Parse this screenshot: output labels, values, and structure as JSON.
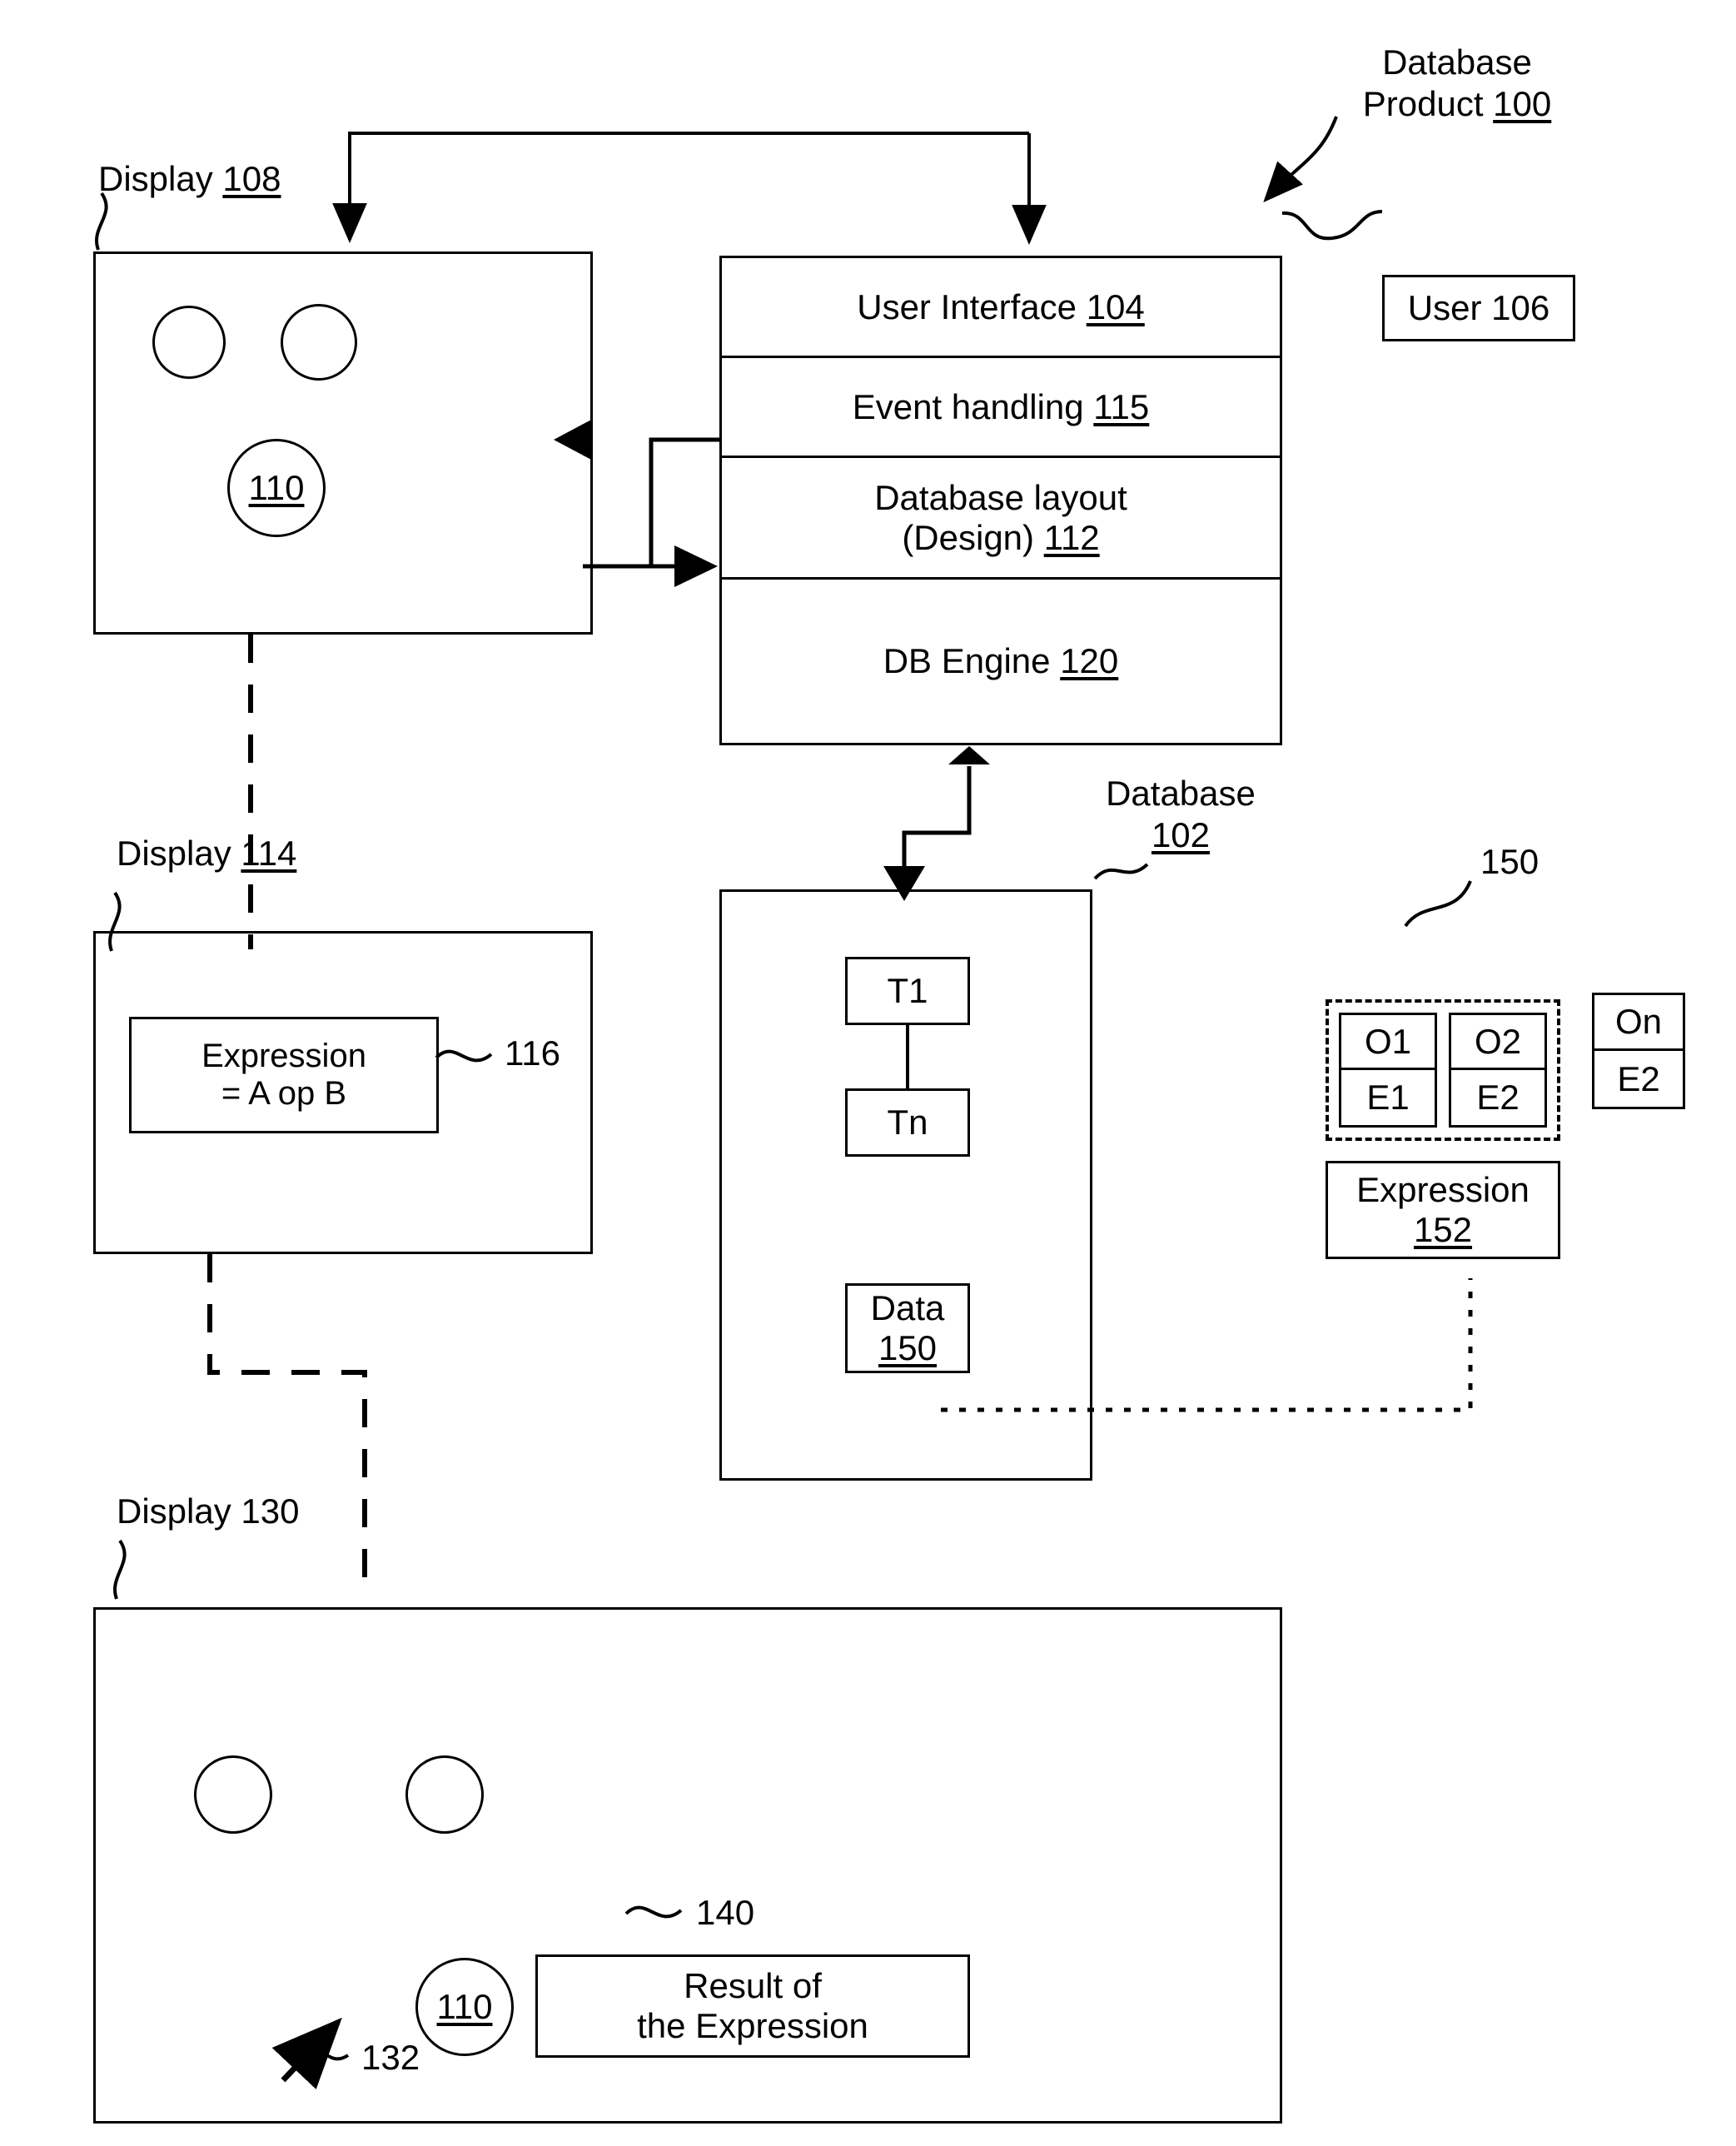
{
  "figure": {
    "domain": "patent-block-diagram",
    "product_callout": {
      "line1": "Database",
      "line2_text": "Product ",
      "line2_num": "100"
    },
    "user_box": {
      "label": "User 106"
    },
    "stack": [
      {
        "name": "user-interface",
        "text": "User Interface ",
        "num": "104"
      },
      {
        "name": "event-handling",
        "text": "Event handling ",
        "num": "115"
      },
      {
        "name": "database-layout",
        "text_line1": "Database layout",
        "text_line2": "(Design) ",
        "num": "112"
      },
      {
        "name": "db-engine",
        "text": "DB Engine ",
        "num": "120"
      }
    ],
    "display_108": {
      "caption_text": "Display ",
      "caption_num": "108",
      "circle_label": "110"
    },
    "display_114": {
      "caption_text": "Display ",
      "caption_num": "114",
      "expression_line1": "Expression",
      "expression_line2": "= A op B",
      "callout": "116"
    },
    "display_130": {
      "caption": "Display 130",
      "circle_label": "110",
      "result_line1": "Result of",
      "result_line2": "the Expression",
      "result_callout": "140",
      "arrow_callout": "132"
    },
    "database_102": {
      "caption_line1": "Database",
      "caption_num": "102",
      "tables": [
        "T1",
        "Tn"
      ],
      "data_box": {
        "text": "Data",
        "num": "150"
      }
    },
    "detail_150": {
      "callout": "150",
      "cells": [
        {
          "top": "O1",
          "bottom": "E1"
        },
        {
          "top": "O2",
          "bottom": "E2"
        }
      ],
      "side_cell": {
        "top": "On",
        "bottom": "E2"
      },
      "expression_box": {
        "text": "Expression",
        "num": "152"
      }
    }
  }
}
